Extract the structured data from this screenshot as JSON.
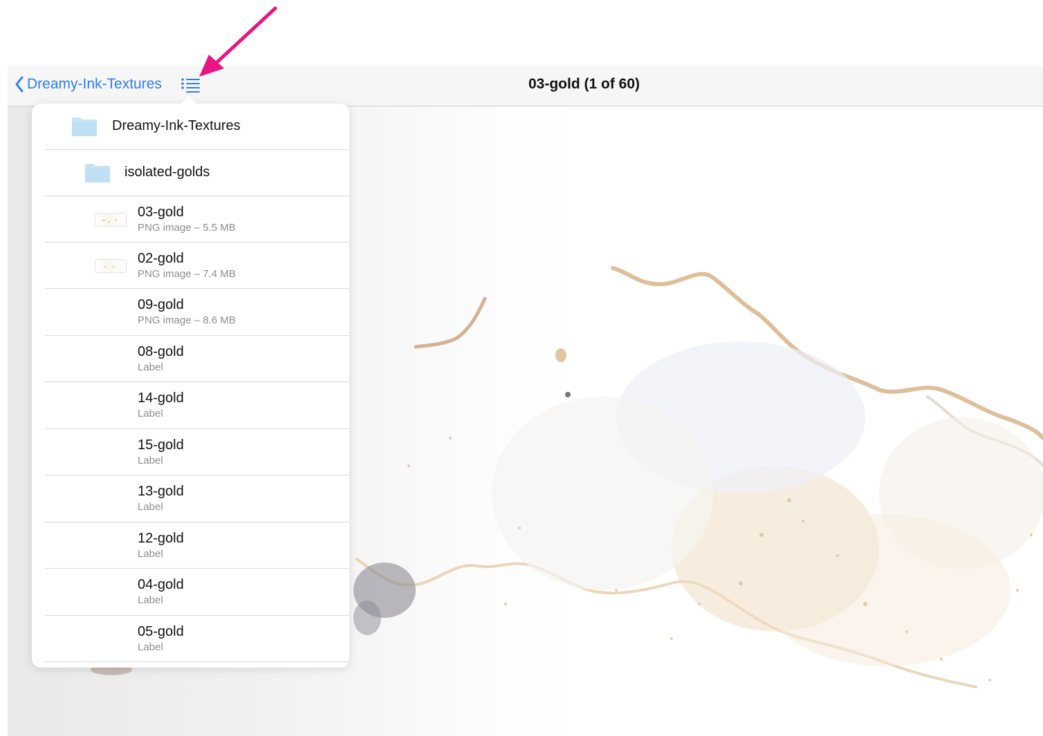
{
  "navbar": {
    "back_label": "Dreamy-Ink-Textures",
    "title": "03-gold (1 of 60)"
  },
  "popover": {
    "items": [
      {
        "title": "Dreamy-Ink-Textures",
        "kind": "folder"
      },
      {
        "title": "isolated-golds",
        "kind": "folder"
      },
      {
        "title": "03-gold",
        "subtitle": "PNG image – 5.5 MB",
        "kind": "image"
      },
      {
        "title": "02-gold",
        "subtitle": "PNG image – 7.4 MB",
        "kind": "image"
      },
      {
        "title": "09-gold",
        "subtitle": "PNG image – 8.6 MB",
        "kind": "image"
      },
      {
        "title": "08-gold",
        "subtitle": "Label",
        "kind": "label"
      },
      {
        "title": "14-gold",
        "subtitle": "Label",
        "kind": "label"
      },
      {
        "title": "15-gold",
        "subtitle": "Label",
        "kind": "label"
      },
      {
        "title": "13-gold",
        "subtitle": "Label",
        "kind": "label"
      },
      {
        "title": "12-gold",
        "subtitle": "Label",
        "kind": "label"
      },
      {
        "title": "04-gold",
        "subtitle": "Label",
        "kind": "label"
      },
      {
        "title": "05-gold",
        "subtitle": "Label",
        "kind": "label"
      }
    ]
  },
  "icons": {
    "back": "chevron-left-icon",
    "list": "list-icon",
    "folder": "folder-icon",
    "thumbnail": "image-thumbnail-icon"
  },
  "colors": {
    "accent": "#2f7cf6",
    "annotation_arrow": "#e6157f",
    "folder": "#c6e3f6",
    "texture_gold": "#d9b98a"
  }
}
